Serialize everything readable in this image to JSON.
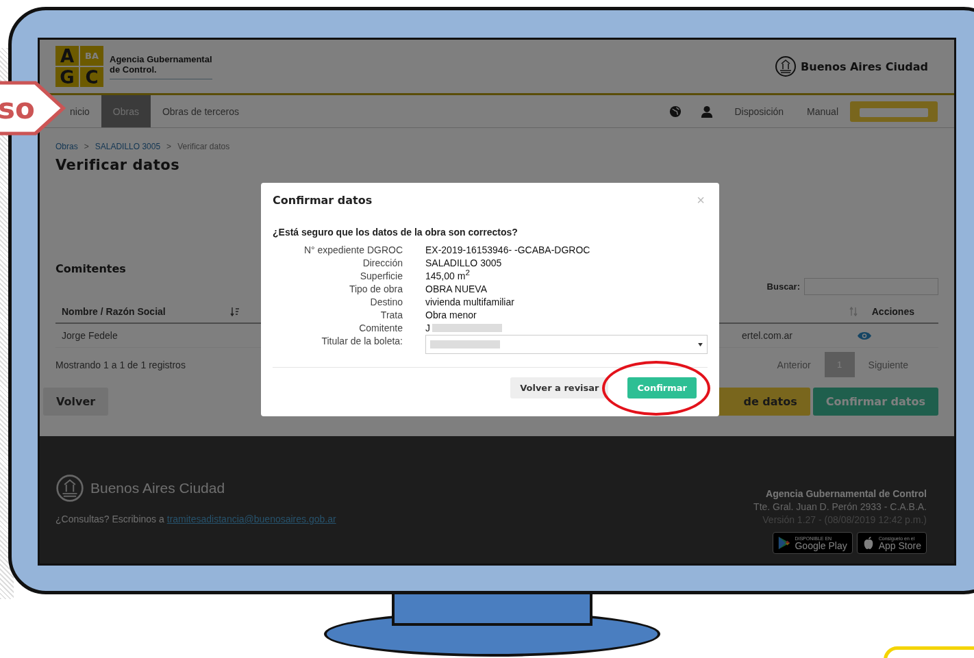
{
  "callout": {
    "text": "so"
  },
  "header": {
    "logo_letters": [
      "A",
      "BA",
      "G",
      "C"
    ],
    "agency_name": [
      "Agencia Gubernamental",
      "de Control."
    ],
    "city_brand": "Buenos Aires Ciudad"
  },
  "nav": {
    "tabs": [
      {
        "label": "nicio",
        "selected": false
      },
      {
        "label": "Obras",
        "selected": true
      },
      {
        "label": "Obras de terceros",
        "selected": false
      }
    ],
    "links": [
      "Disposición",
      "Manual"
    ]
  },
  "breadcrumbs": [
    {
      "kind": "link",
      "text": "Obras"
    },
    {
      "kind": "separator",
      "text": ">"
    },
    {
      "kind": "link",
      "text": "SALADILLO 3005"
    },
    {
      "kind": "separator",
      "text": ">"
    },
    {
      "kind": "current",
      "text": "Verificar datos"
    }
  ],
  "page_title": "Verificar datos",
  "section_title": "Comitentes",
  "search": {
    "label": "Buscar:"
  },
  "table": {
    "columns": [
      {
        "label": "Nombre / Razón Social"
      },
      {
        "label": "Acciones"
      }
    ],
    "rows": [
      {
        "cells": [
          "Jorge Fedele",
          "ertel.com.ar"
        ]
      }
    ]
  },
  "table_info": "Mostrando 1 a 1 de 1 registros",
  "pagination": {
    "previous": "Anterior",
    "pages": [
      {
        "label": "1",
        "selected": true
      }
    ],
    "next": "Siguiente"
  },
  "actions": {
    "back": "Volver",
    "partial": "de datos",
    "confirm": "Confirmar datos"
  },
  "footer": {
    "brand": "Buenos Aires Ciudad",
    "contact_text": "¿Consultas? Escribinos a",
    "contact_link": "tramitesadistancia@buenosaires.gob.ar",
    "agency": [
      "Agencia Gubernamental de Control",
      "Tte. Gral. Juan D. Perón 2933 - C.A.B.A.",
      "Versión 1.27 - (08/08/2019 12:42 p.m.)"
    ],
    "badges": [
      {
        "kind": "google",
        "small": "DISPONIBLE EN",
        "big": "Google Play"
      },
      {
        "kind": "apple",
        "small": "Consíguelo en el",
        "big": "App Store"
      }
    ]
  },
  "modal": {
    "title": "Confirmar datos",
    "close": "×",
    "question": "¿Está seguro que los datos de la obra son correctos?",
    "fields": [
      {
        "kind": "text",
        "label": "N° expediente DGROC",
        "value": "EX-2019-16153946- -GCABA-DGROC"
      },
      {
        "kind": "text",
        "label": "Dirección",
        "value": "SALADILLO 3005"
      },
      {
        "kind": "text",
        "label": "Superficie",
        "value": "145,00 m$^{2}$"
      },
      {
        "kind": "text",
        "label": "Tipo de obra",
        "value": "OBRA NUEVA"
      },
      {
        "kind": "text",
        "label": "Destino",
        "value": "vivienda multifamiliar"
      },
      {
        "kind": "text",
        "label": "Trata",
        "value": "Obra menor"
      },
      {
        "kind": "redacted",
        "label": "Comitente",
        "value": "J"
      },
      {
        "kind": "select",
        "label": "Titular de la boleta:"
      }
    ],
    "buttons": {
      "back": "Volver a revisar",
      "confirm": "Confirmar"
    }
  }
}
